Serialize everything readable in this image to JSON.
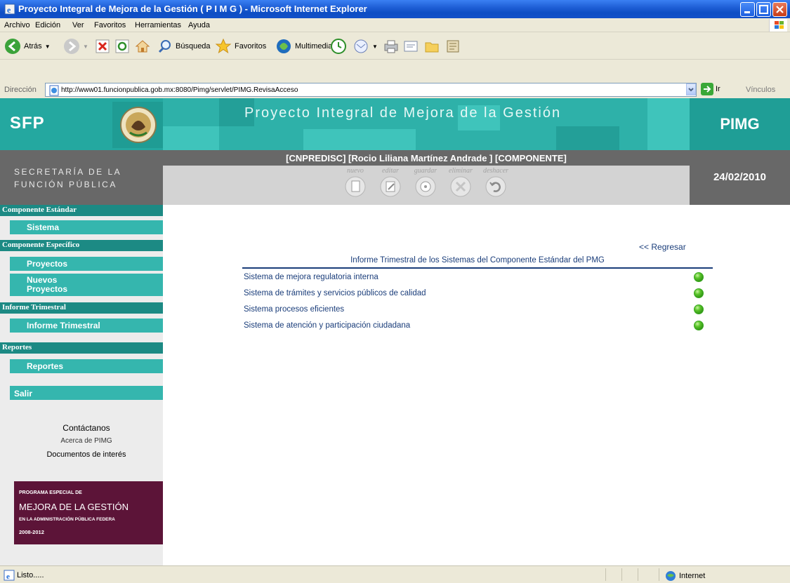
{
  "window": {
    "title": "Proyecto Integral de Mejora de la Gestión ( P I M G ) - Microsoft Internet Explorer"
  },
  "menu": [
    "Archivo",
    "Edición",
    "Ver",
    "Favoritos",
    "Herramientas",
    "Ayuda"
  ],
  "toolbar": {
    "back_label": "Atrás",
    "search_label": "Búsqueda",
    "favorites_label": "Favoritos",
    "media_label": "Multimedia"
  },
  "address": {
    "label": "Dirección",
    "url": "http://www01.funcionpublica.gob.mx:8080/Pimg/servlet/PIMG.RevisaAcceso",
    "go_label": "Ir",
    "links_label": "Vínculos"
  },
  "header": {
    "sfp_logo": "SFP",
    "banner_title": "Proyecto Integral de Mejora de la Gestión",
    "pimg_logo": "PIMG",
    "secretaria_line1": "SECRETARÍA DE LA",
    "secretaria_line2": "FUNCIÓN PÚBLICA",
    "user_line": "[CNPREDISC] [Rocio Liliana Martínez Andrade ] [COMPONENTE]",
    "date": "24/02/2010",
    "actions": [
      "nuevo",
      "editar",
      "guardar",
      "eliminar",
      "deshacer"
    ]
  },
  "sidebar": {
    "componente_estandar": "Componente Estándar",
    "sistema": "Sistema",
    "componente_especifico": "Componente Específico",
    "proyectos": "Proyectos",
    "nuevos_line1": "Nuevos",
    "nuevos_line2": "Proyectos",
    "informe_trimestral_hdr": "Informe Trimestral",
    "informe_trimestral": "Informe Trimestral",
    "reportes_hdr": "Reportes",
    "reportes": "Reportes",
    "salir": "Salir",
    "contactanos": "Contáctanos",
    "acerca": "Acerca de PIMG",
    "documentos": "Documentos de interés",
    "programa": {
      "line1": "PROGRAMA ESPECIAL DE",
      "line2": "MEJORA DE LA GESTIÓN",
      "line3": "EN LA ADMINISTRACIÓN PÚBLICA FEDERA",
      "line4": "2008-2012"
    }
  },
  "main": {
    "regresar": "<< Regresar",
    "report_title": "Informe Trimestral de los Sistemas del Componente Estándar del PMG",
    "rows": [
      {
        "label": "Sistema de mejora regulatoria interna",
        "status_color": "#3aa820"
      },
      {
        "label": "Sistema de trámites y servicios públicos de calidad",
        "status_color": "#3aa820"
      },
      {
        "label": "Sistema procesos eficientes",
        "status_color": "#3aa820"
      },
      {
        "label": "Sistema de atención y participación ciudadana",
        "status_color": "#3aa820"
      }
    ]
  },
  "status": {
    "text": "Listo.....",
    "zone": "Internet"
  }
}
